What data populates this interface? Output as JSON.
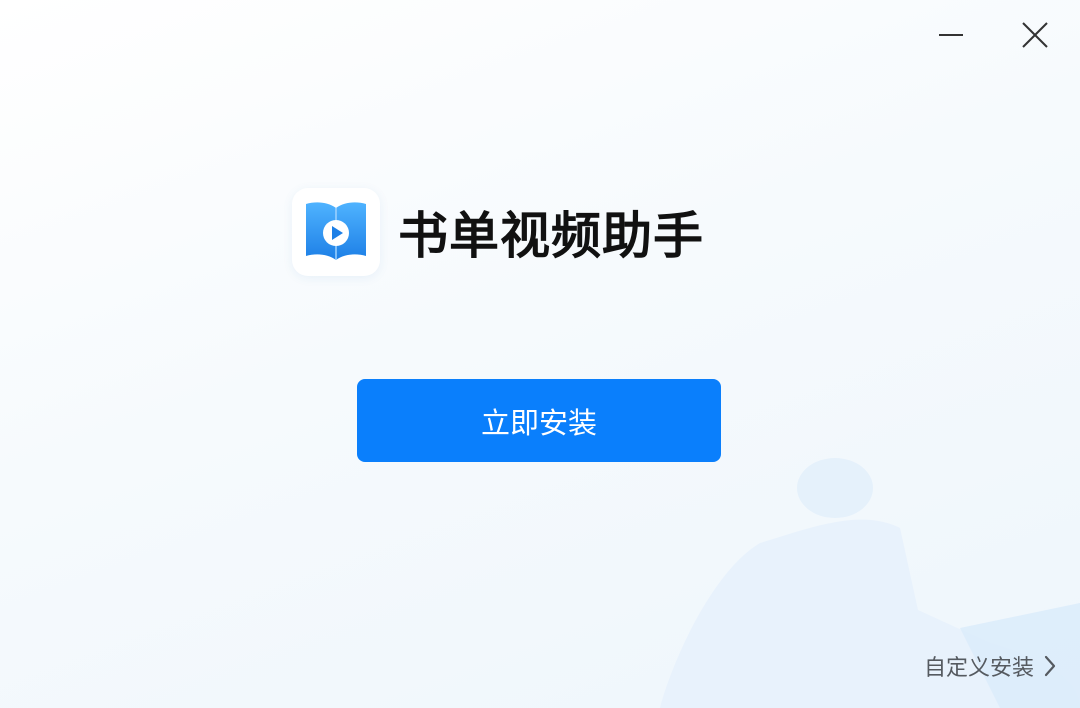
{
  "window": {
    "minimize_icon": "minimize-icon",
    "close_icon": "close-icon"
  },
  "brand": {
    "icon": "book-play-icon",
    "app_name": "书单视频助手"
  },
  "actions": {
    "install_label": "立即安装",
    "custom_install_label": "自定义安装",
    "custom_install_icon": "chevron-right-icon"
  },
  "colors": {
    "accent": "#0a7ffc",
    "icon_blue": "#2d8cf0"
  }
}
